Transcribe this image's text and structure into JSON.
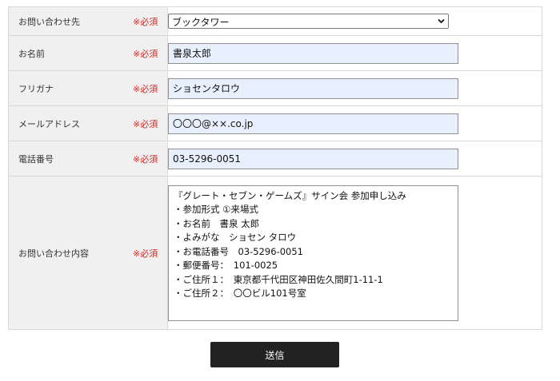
{
  "form": {
    "required_mark": "※必須",
    "rows": {
      "inquiry_to": {
        "label": "お問い合わせ先",
        "value": "ブックタワー"
      },
      "name": {
        "label": "お名前",
        "value": "書泉太郎"
      },
      "furigana": {
        "label": "フリガナ",
        "value": "ショセンタロウ"
      },
      "email": {
        "label": "メールアドレス",
        "value": "〇〇〇@××.co.jp"
      },
      "phone": {
        "label": "電話番号",
        "value": "03-5296-0051"
      },
      "message": {
        "label": "お問い合わせ内容",
        "lines": [
          "『グレート・セブン・ゲームズ』サイン会 参加申し込み",
          "・参加形式 ①来場式",
          "・お名前　書泉 太郎",
          "・よみがな　ショセン タロウ",
          "・お電話番号　03-5296-0051",
          "・郵便番号：　101-0025",
          "・ご住所１：　東京都千代田区神田佐久間町1-11-1",
          "・ご住所２：　〇〇ビル101号室"
        ]
      }
    },
    "submit_label": "送信"
  },
  "colors": {
    "required": "#e02222",
    "label_bg": "#f0f0f0",
    "autofill_bg": "#e8f0fe",
    "button_bg": "#222222"
  },
  "icons": {
    "select_arrow": "chevron-down-icon"
  }
}
